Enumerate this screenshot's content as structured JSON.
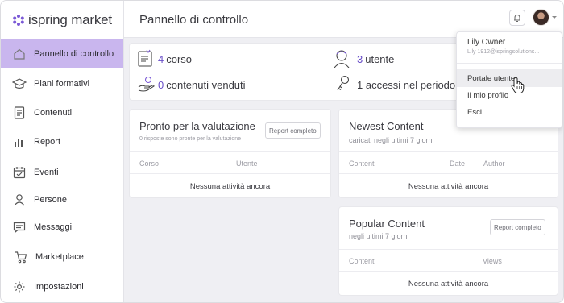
{
  "logo": {
    "brand": "ispring market"
  },
  "sidebar": {
    "items": [
      {
        "label": "Pannello di controllo",
        "icon": "home-icon"
      },
      {
        "label": "Piani formativi",
        "icon": "graduation-cap-icon"
      },
      {
        "label": "Contenuti",
        "icon": "document-icon"
      },
      {
        "label": "Report",
        "icon": "bar-chart-icon"
      },
      {
        "label": "Eventi",
        "icon": "calendar-icon"
      },
      {
        "label": "Persone",
        "icon": "person-icon"
      },
      {
        "label": "Messaggi",
        "icon": "message-icon"
      },
      {
        "label": "Marketplace",
        "icon": "cart-icon"
      },
      {
        "label": "Impostazioni",
        "icon": "gear-icon"
      }
    ]
  },
  "header": {
    "title": "Pannello di controllo"
  },
  "stats": {
    "courses_num": "4",
    "courses_label": "corso",
    "sold_num": "0",
    "sold_label": "contenuti venduti",
    "users_num": "3",
    "users_label": "utente",
    "access_label": "1 accessi nel periodo"
  },
  "valuation": {
    "title": "Pronto per la valutazione",
    "subtitle": "0 risposte sono pronte per la valutazione",
    "report_button": "Report completo",
    "col_course": "Corso",
    "col_user": "Utente",
    "empty": "Nessuna attività ancora"
  },
  "newest": {
    "title": "Newest Content",
    "subtitle": "caricati negli ultimi 7 giorni",
    "col_content": "Content",
    "col_date": "Date",
    "col_author": "Author",
    "empty": "Nessuna attività ancora"
  },
  "popular": {
    "title": "Popular Content",
    "subtitle": "negli ultimi 7 giorni",
    "report_button": "Report completo",
    "col_content": "Content",
    "col_views": "Views",
    "empty": "Nessuna attività ancora"
  },
  "user_menu": {
    "name": "Lily Owner",
    "email": "Lily 1912@ispringsolutions...",
    "items": [
      "Portale utente",
      "Il mio profilo",
      "Esci"
    ]
  },
  "colors": {
    "accent": "#6a4fc8",
    "active_nav": "#c9b6ee"
  }
}
